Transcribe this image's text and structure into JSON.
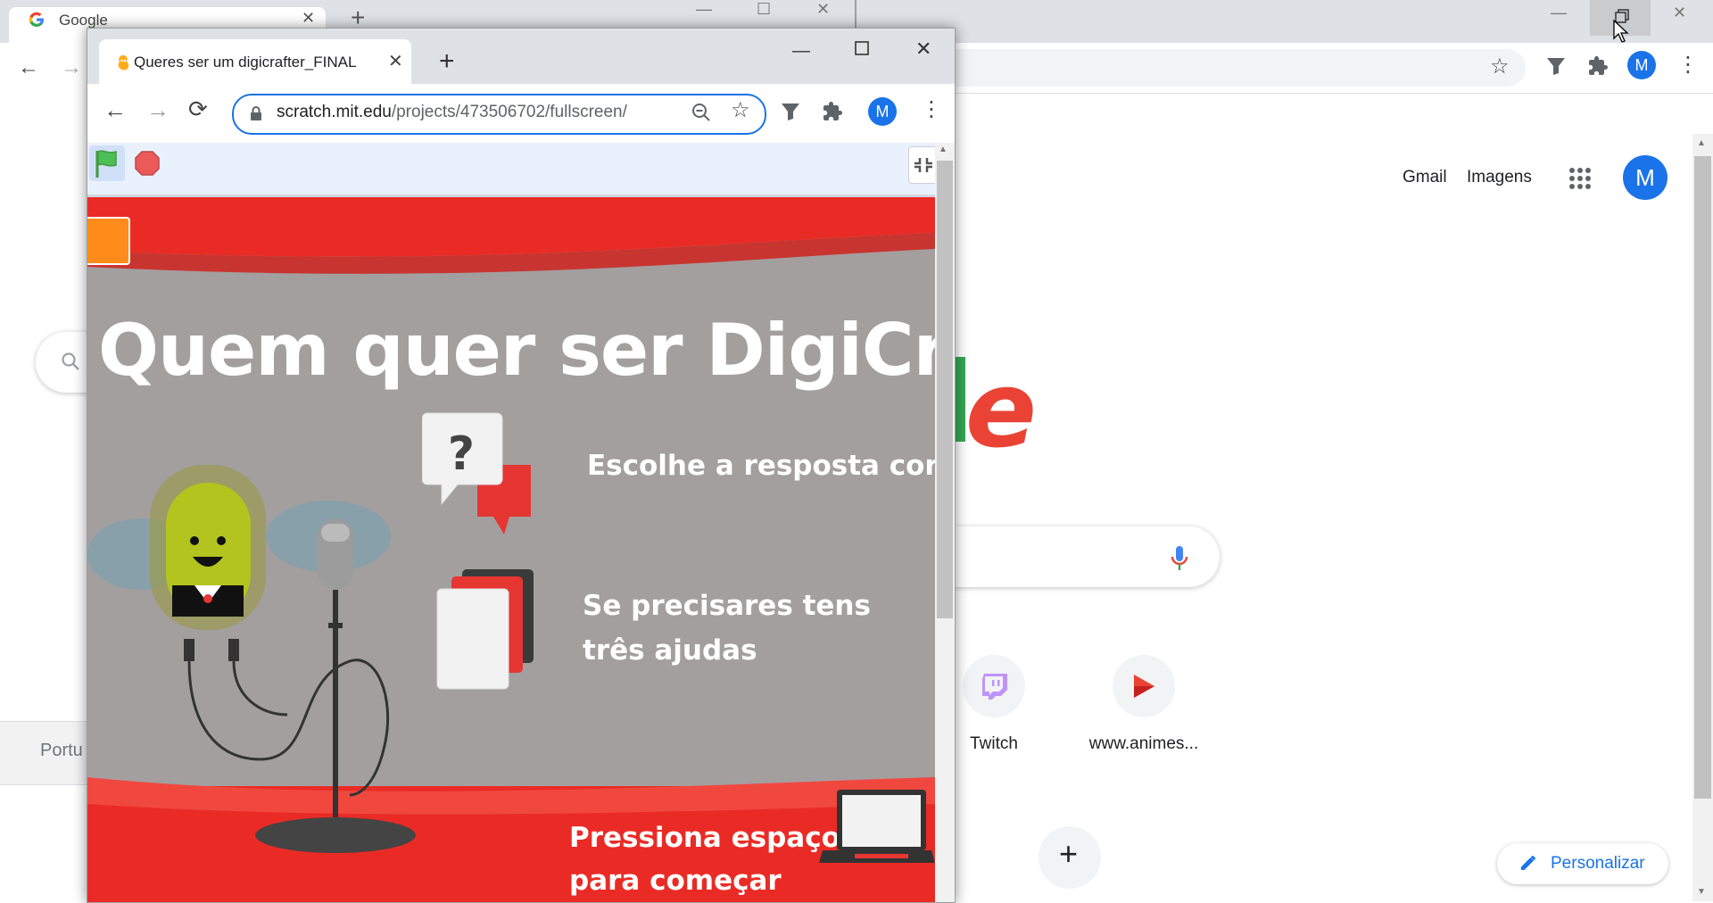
{
  "background_window": {
    "tab_title": "Google",
    "header_links": {
      "gmail": "Gmail",
      "images": "Imagens"
    },
    "avatar_letter": "M",
    "logo_partial": "le",
    "shortcuts": [
      {
        "label": "Twitch",
        "icon": "twitch-icon"
      },
      {
        "label": "www.animes...",
        "icon": "play-icon"
      }
    ],
    "customize_label": "Personalizar",
    "footer_partial": "Portu",
    "colors": {
      "logo_green": "#34a853",
      "logo_red": "#ea4335",
      "accent": "#1a73e8"
    }
  },
  "foreground_window": {
    "tab_title": "Queres ser um digicrafter_FINAL",
    "url_host": "scratch.mit.edu",
    "url_path": "/projects/473506702/fullscreen/",
    "avatar_letter": "M",
    "stage": {
      "title": "Quem quer ser DigiCrafter?",
      "line1": "Escolhe a resposta correta",
      "line2a": "Se precisares tens",
      "line2b": "três ajudas",
      "line3a": "Pressiona espaço",
      "line3b": "para começar"
    },
    "colors": {
      "stage_bg": "#a39f9f",
      "stage_red": "#ea2b25",
      "omnibox_border": "#1a73e8"
    }
  }
}
